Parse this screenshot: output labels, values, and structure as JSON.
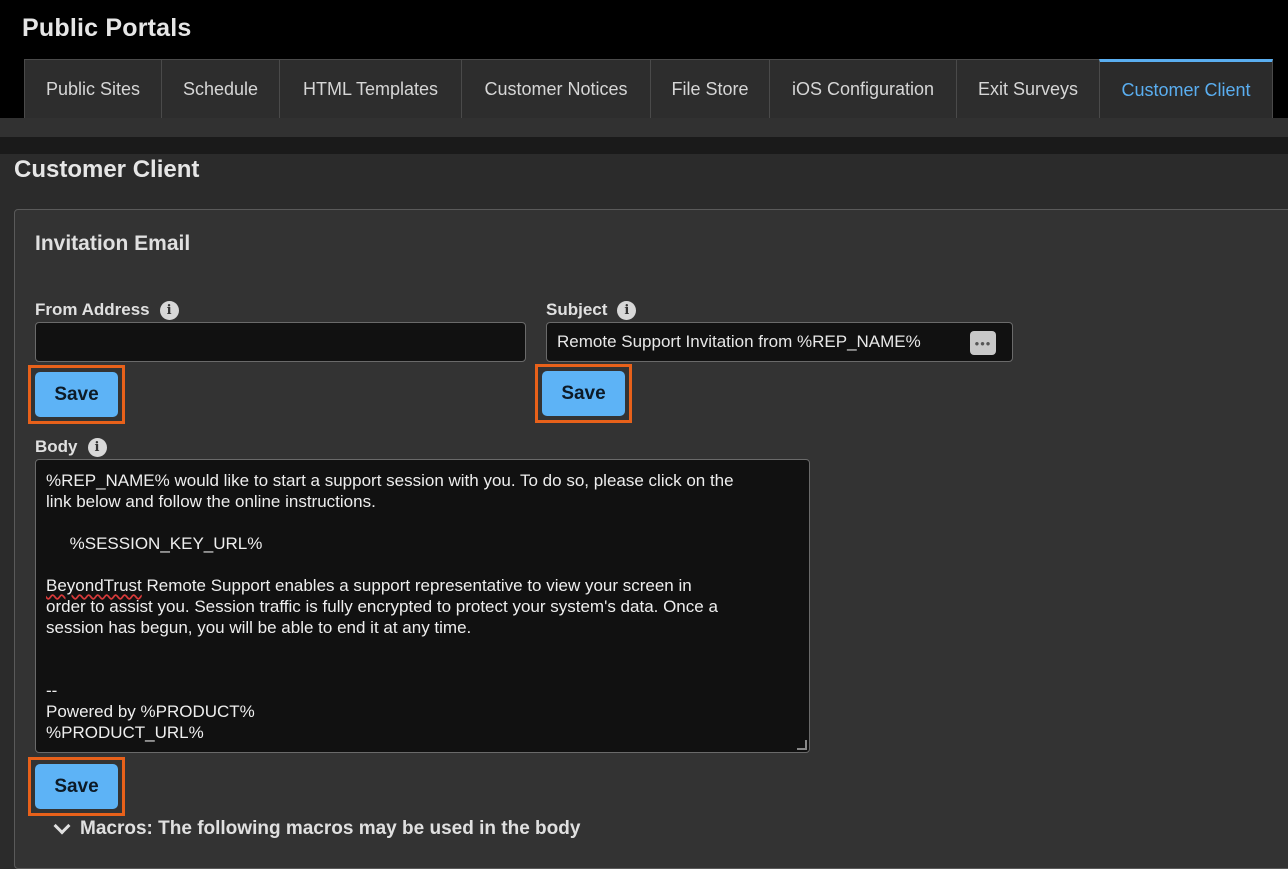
{
  "app": {
    "title": "Public Portals"
  },
  "tabs": [
    {
      "label": "Public Sites",
      "active": false
    },
    {
      "label": "Schedule",
      "active": false
    },
    {
      "label": "HTML Templates",
      "active": false
    },
    {
      "label": "Customer Notices",
      "active": false
    },
    {
      "label": "File Store",
      "active": false
    },
    {
      "label": "iOS Configuration",
      "active": false
    },
    {
      "label": "Exit Surveys",
      "active": false
    },
    {
      "label": "Customer Client",
      "active": true
    }
  ],
  "page": {
    "title": "Customer Client"
  },
  "invitation": {
    "section_title": "Invitation Email",
    "from_address": {
      "label": "From Address",
      "value": ""
    },
    "subject": {
      "label": "Subject",
      "value": "Remote Support Invitation from %REP_NAME%",
      "macro_icon": "ellipsis-icon"
    },
    "body": {
      "label": "Body",
      "lines": [
        "%REP_NAME% would like to start a support session with you. To do so, please click on the",
        "link below and follow the online instructions.",
        "",
        "     %SESSION_KEY_URL%",
        "",
        "BeyondTrust Remote Support enables a support representative to view your screen in",
        "order to assist you. Session traffic is fully encrypted to protect your system's data. Once a",
        "session has begun, you will be able to end it at any time.",
        "",
        "",
        "--",
        "Powered by %PRODUCT%",
        "%PRODUCT_URL%"
      ]
    },
    "save_label": "Save",
    "macros_label": "Macros: The following macros may be used in the body"
  },
  "colors": {
    "accent": "#5aaef0",
    "save_button": "#5db3f6",
    "highlight_border": "#e8611a"
  }
}
